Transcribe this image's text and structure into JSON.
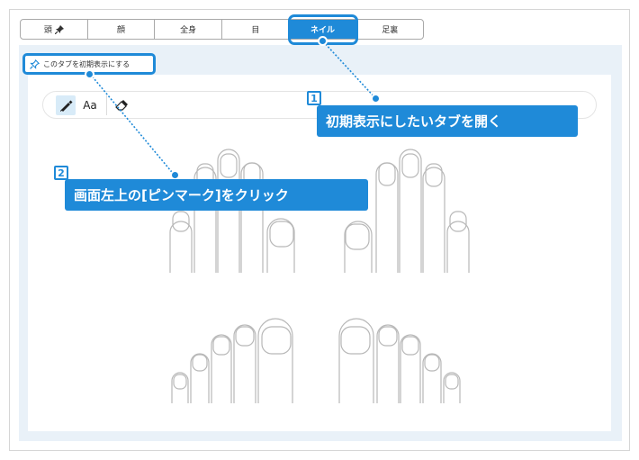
{
  "tabs": [
    {
      "label": "頭",
      "pinned": true
    },
    {
      "label": "顔"
    },
    {
      "label": "全身"
    },
    {
      "label": "目"
    },
    {
      "label": "ネイル",
      "active": true
    },
    {
      "label": "足裏"
    }
  ],
  "pin_link_label": "このタブを初期表示にする",
  "toolbar": {
    "text_tool_label": "Aa"
  },
  "callouts": [
    {
      "number": "1",
      "text": "初期表示にしたいタブを開く"
    },
    {
      "number": "2",
      "text": "画面左上の[ピンマーク]をクリック"
    }
  ],
  "colors": {
    "accent": "#1f8ad8",
    "panel": "#e9f1f8",
    "outline": "#b8b8b8"
  }
}
